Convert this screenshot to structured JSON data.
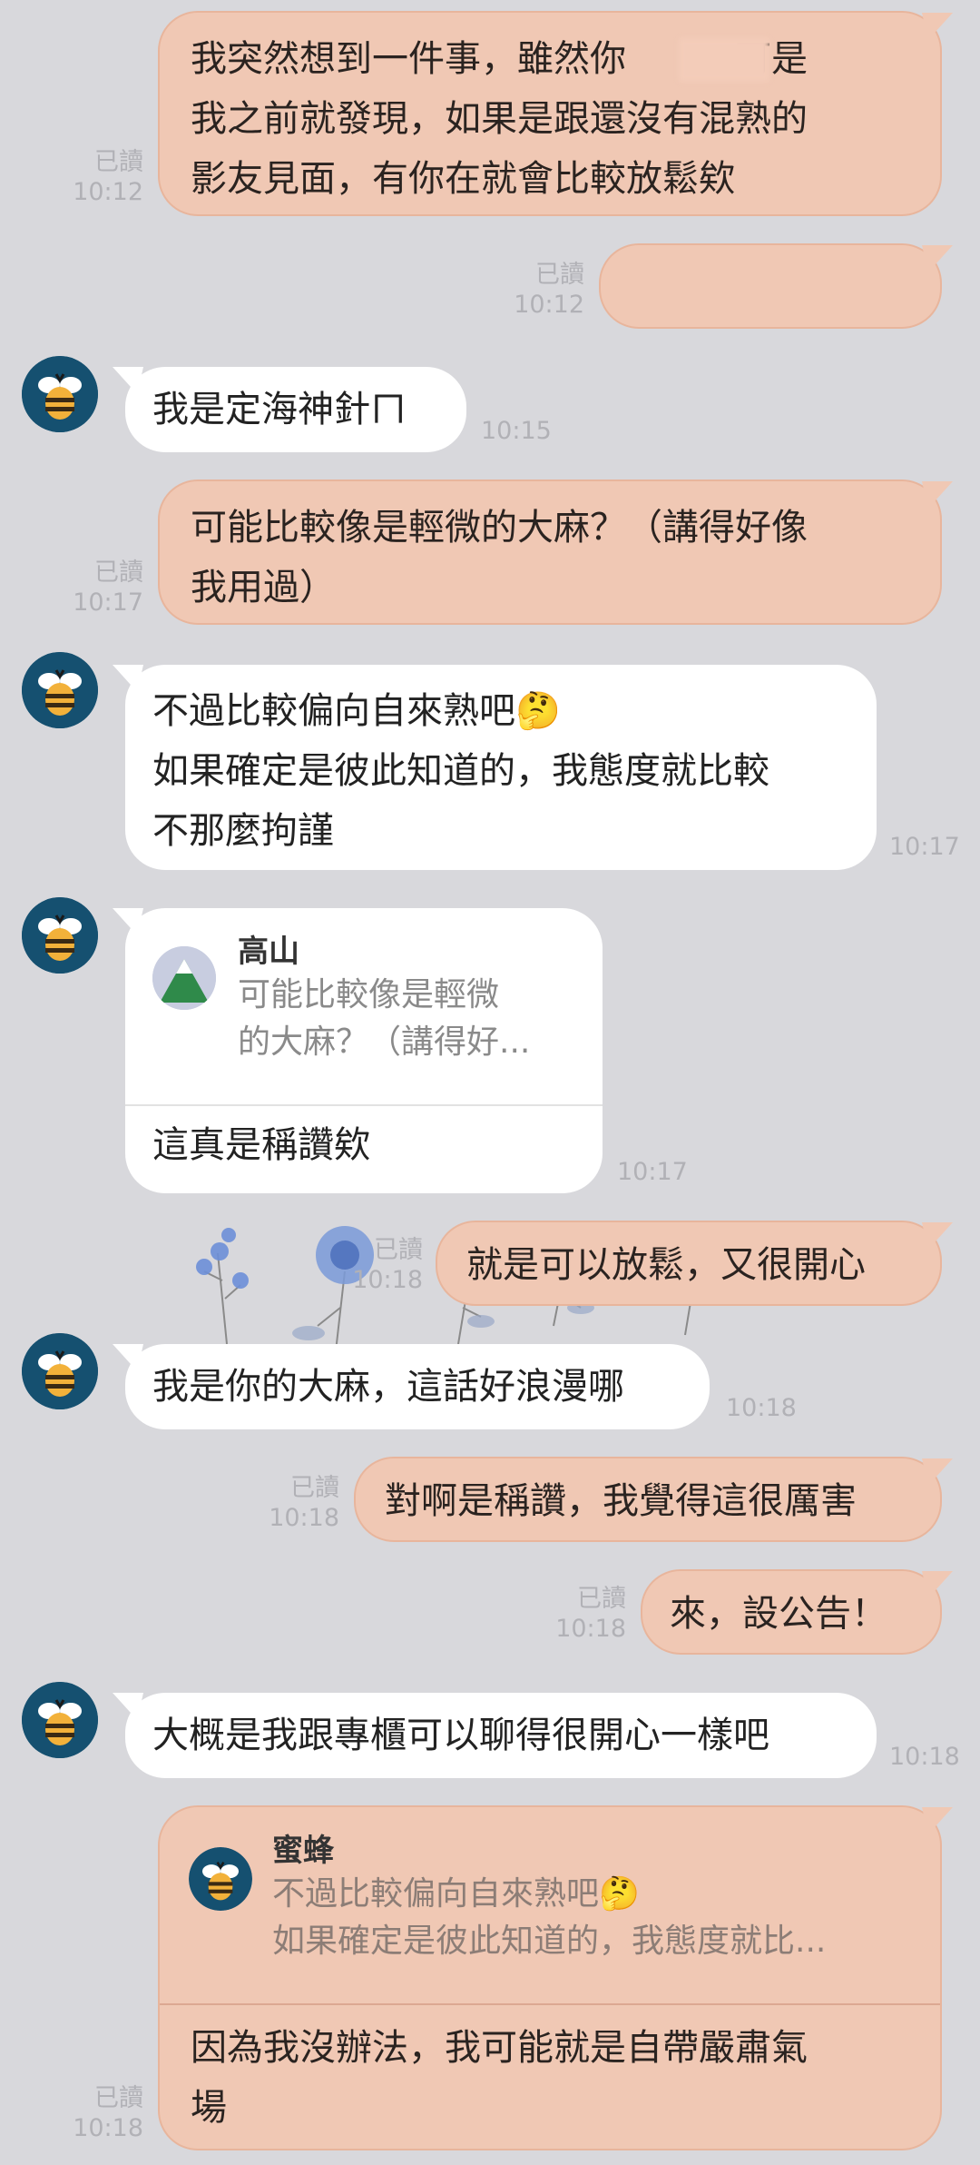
{
  "colors": {
    "background": "#d8d8dc",
    "my_bubble": "#f0c8b4",
    "their_bubble": "#ffffff",
    "meta_text": "#b1b1b6",
    "avatar_bg": "#155070"
  },
  "read_label": "已讀",
  "messages": [
    {
      "side": "me",
      "text": "我突然想到一件事，雖然你　　，可是\n我之前就發現，如果是跟還沒有混熟的\n影友見面，有你在就會比較放鬆欸",
      "read": "已讀",
      "time": "10:12"
    },
    {
      "side": "me",
      "text": "",
      "read": "已讀",
      "time": "10:12"
    },
    {
      "side": "them",
      "icon": "bee-avatar-icon",
      "text": "我是定海神針ㄇ",
      "time": "10:15"
    },
    {
      "side": "me",
      "text": "可能比較像是輕微的大麻？（講得好像\n我用過）",
      "read": "已讀",
      "time": "10:17"
    },
    {
      "side": "them",
      "icon": "bee-avatar-icon",
      "text": "不過比較偏向自來熟吧🤔\n如果確定是彼此知道的，我態度就比較\n不那麼拘謹",
      "time": "10:17"
    },
    {
      "side": "them",
      "icon": "bee-avatar-icon",
      "quote": {
        "name": "高山",
        "icon": "mountain-avatar-icon",
        "text": "可能比較像是輕微\n的大麻？（講得好..."
      },
      "text": "這真是稱讚欸",
      "time": "10:17"
    },
    {
      "side": "me",
      "text": "就是可以放鬆，又很開心",
      "read": "已讀",
      "time": "10:18"
    },
    {
      "side": "them",
      "icon": "bee-avatar-icon",
      "text": "我是你的大麻，這話好浪漫哪",
      "time": "10:18"
    },
    {
      "side": "me",
      "text": "對啊是稱讚，我覺得這很厲害",
      "read": "已讀",
      "time": "10:18"
    },
    {
      "side": "me",
      "text": "來，設公告！",
      "read": "已讀",
      "time": "10:18"
    },
    {
      "side": "them",
      "icon": "bee-avatar-icon",
      "text": "大概是我跟專櫃可以聊得很開心一樣吧",
      "time": "10:18"
    },
    {
      "side": "me",
      "quote": {
        "name": "蜜蜂",
        "icon": "bee-avatar-icon",
        "text": "不過比較偏向自來熟吧🤔\n如果確定是彼此知道的，我態度就比..."
      },
      "text": "因為我沒辦法，我可能就是自帶嚴肅氣\n場",
      "read": "已讀",
      "time": "10:18"
    }
  ]
}
